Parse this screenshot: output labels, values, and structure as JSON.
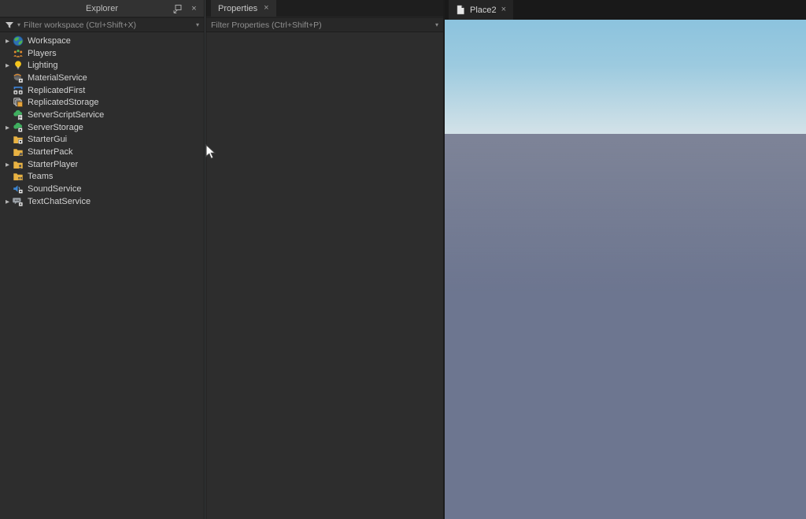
{
  "explorer": {
    "title": "Explorer",
    "filter_placeholder": "Filter workspace (Ctrl+Shift+X)",
    "items": [
      {
        "label": "Workspace",
        "icon": "workspace-globe",
        "expandable": true
      },
      {
        "label": "Players",
        "icon": "players",
        "expandable": false
      },
      {
        "label": "Lighting",
        "icon": "lighting-bulb",
        "expandable": true
      },
      {
        "label": "MaterialService",
        "icon": "material-service",
        "expandable": false
      },
      {
        "label": "ReplicatedFirst",
        "icon": "replicated-first",
        "expandable": false
      },
      {
        "label": "ReplicatedStorage",
        "icon": "replicated-storage",
        "expandable": false
      },
      {
        "label": "ServerScriptService",
        "icon": "server-script-service",
        "expandable": false
      },
      {
        "label": "ServerStorage",
        "icon": "server-storage",
        "expandable": true
      },
      {
        "label": "StarterGui",
        "icon": "starter-gui",
        "expandable": false
      },
      {
        "label": "StarterPack",
        "icon": "starter-pack",
        "expandable": false
      },
      {
        "label": "StarterPlayer",
        "icon": "starter-player",
        "expandable": true
      },
      {
        "label": "Teams",
        "icon": "teams",
        "expandable": false
      },
      {
        "label": "SoundService",
        "icon": "sound-service",
        "expandable": false
      },
      {
        "label": "TextChatService",
        "icon": "text-chat-service",
        "expandable": true
      }
    ]
  },
  "properties": {
    "tab_label": "Properties",
    "filter_placeholder": "Filter Properties (Ctrl+Shift+P)"
  },
  "viewport": {
    "tab_label": "Place2"
  },
  "icons": {
    "close_glyph": "×",
    "caret_down_glyph": "▾",
    "expand_arrow_glyph": "▶"
  },
  "colors": {
    "panel_bg": "#2d2d2d",
    "tabbar_bg": "#1e1e1e",
    "sky_top": "#8cc3de",
    "sky_horizon": "#d3e2e8",
    "ground_light": "#747e97",
    "ground_dark": "#68728c",
    "grid_line": "#4e5874"
  }
}
